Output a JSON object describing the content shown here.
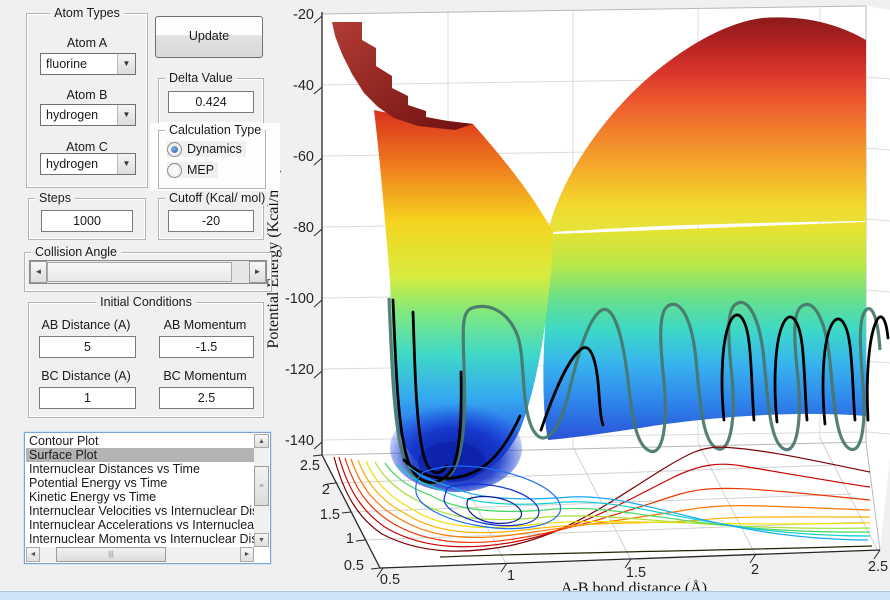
{
  "controls": {
    "atom_types": {
      "title": "Atom Types",
      "items": [
        {
          "label": "Atom A",
          "value": "fluorine"
        },
        {
          "label": "Atom B",
          "value": "hydrogen"
        },
        {
          "label": "Atom C",
          "value": "hydrogen"
        }
      ]
    },
    "update_label": "Update",
    "delta": {
      "title": "Delta Value",
      "value": "0.424"
    },
    "calc": {
      "title": "Calculation Type",
      "options": [
        {
          "label": "Dynamics",
          "selected": true
        },
        {
          "label": "MEP",
          "selected": false
        }
      ]
    },
    "steps": {
      "title": "Steps",
      "value": "1000"
    },
    "cutoff": {
      "title": "Cutoff (Kcal/ mol)",
      "value": "-20"
    },
    "collision": {
      "title": "Collision Angle"
    },
    "initial": {
      "title": "Initial Conditions",
      "fields": [
        {
          "label": "AB Distance (A)",
          "value": "5"
        },
        {
          "label": "AB Momentum",
          "value": "-1.5"
        },
        {
          "label": "BC Distance (A)",
          "value": "1"
        },
        {
          "label": "BC Momentum",
          "value": "2.5"
        }
      ]
    },
    "plot_list": {
      "selected": "Surface Plot",
      "items": [
        "Contour Plot",
        "Surface Plot",
        "Internuclear Distances vs Time",
        "Potential Energy vs Time",
        "Kinetic Energy vs Time",
        "Internuclear Velocities vs Internuclear Distance",
        "Internuclear Accelerations vs Internuclear Distance",
        "Internuclear Momenta vs Internuclear Distance"
      ]
    }
  },
  "chart_data": {
    "type": "surface",
    "subtype": "3d-potential-energy-surface-with-contour-base-and-trajectory",
    "colormap": "jet",
    "xlabel": "A-B bond distance (Å)",
    "zlabel": "Potential Energy (Kcal/mol)",
    "x_ticks": [
      "0.5",
      "1",
      "1.5",
      "2",
      "2.5"
    ],
    "y_ticks": [
      "2.5",
      "2",
      "1.5",
      "1",
      "0.5"
    ],
    "z_ticks": [
      "-20",
      "-40",
      "-60",
      "-80",
      "-100",
      "-120",
      "-140"
    ],
    "x_range": [
      0.5,
      2.5
    ],
    "y_range": [
      0.5,
      2.5
    ],
    "z_range": [
      -140,
      -20
    ],
    "cutoff_kcal_mol": -20,
    "surface_minimum_region": {
      "ab": 0.9,
      "bc": 0.75,
      "z": -140
    },
    "overlays": [
      "black reactive trajectory with product vibrations",
      "dark-teal trajectory projection",
      "jet-colored contour lines on base plane"
    ],
    "accent_colors": {
      "surface_high": "#8c1a1a",
      "surface_low": "#1a2fd0",
      "trajectory": "#000000",
      "trajectory_shadow": "#47766b"
    }
  }
}
